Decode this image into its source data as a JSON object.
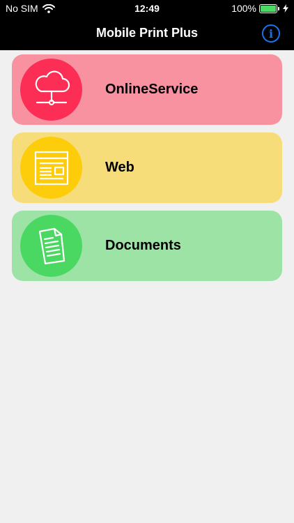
{
  "status_bar": {
    "carrier": "No SIM",
    "time": "12:49",
    "battery": "100%",
    "battery_level": 1.0
  },
  "navbar": {
    "title": "Mobile Print Plus",
    "info_icon": "i"
  },
  "colors": {
    "online_card": "#f992a0",
    "online_circle": "#fc2e55",
    "web_card": "#f7dc7a",
    "web_circle": "#fdcc0b",
    "docs_card": "#9de3a6",
    "docs_circle": "#4bd862",
    "info_accent": "#1a73e8",
    "battery_green": "#4cd964"
  },
  "menu": {
    "items": [
      {
        "label": "OnlineService",
        "icon": "cloud-network-icon"
      },
      {
        "label": "Web",
        "icon": "web-page-icon"
      },
      {
        "label": "Documents",
        "icon": "document-icon"
      }
    ]
  }
}
